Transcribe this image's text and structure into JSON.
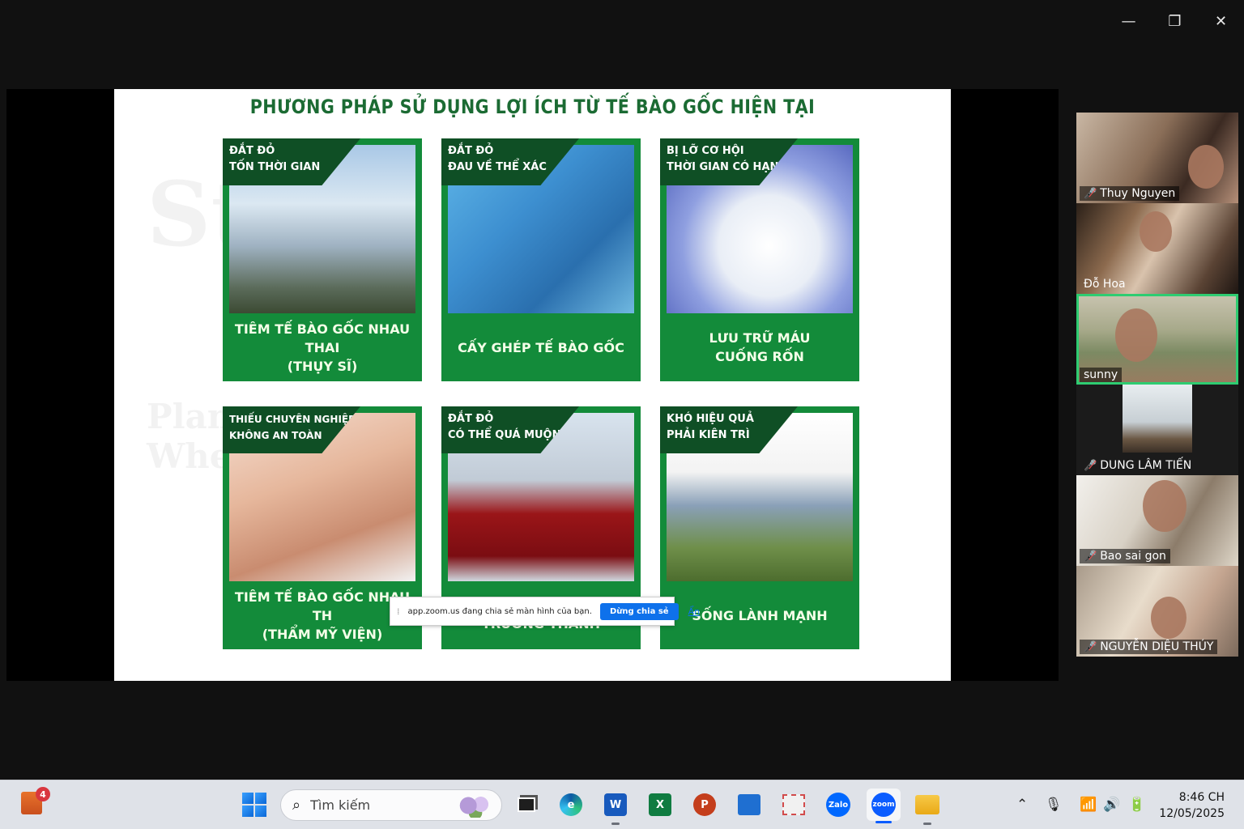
{
  "window_controls": {
    "minimize": "—",
    "restore": "❐",
    "close": "✕"
  },
  "slide": {
    "title": "PHƯƠNG PHÁP SỬ DỤNG LỢI ÍCH TỪ TẾ BÀO GỐC HIỆN TẠI",
    "cards": [
      {
        "tag": [
          "ĐẮT ĐỎ",
          "TỐN THỜI GIAN"
        ],
        "caption": [
          "TIÊM TẾ BÀO GỐC NHAU THAI",
          "(THỤY SĨ)"
        ]
      },
      {
        "tag": [
          "ĐẮT ĐỎ",
          "ĐAU VỀ THỂ XÁC"
        ],
        "caption": [
          "CẤY GHÉP TẾ BÀO GỐC"
        ]
      },
      {
        "tag": [
          "BỊ LỠ CƠ HỘI",
          "THỜI GIAN CÓ HẠN"
        ],
        "caption": [
          "LƯU TRỮ MÁU",
          "CUỐNG RỐN"
        ]
      },
      {
        "tag": [
          "THIẾU CHUYÊN NGHIỆP",
          "KHÔNG AN TOÀN"
        ],
        "caption": [
          "TIÊM TẾ BÀO GỐC NHAU TH",
          "(THẨM MỸ VIỆN)"
        ]
      },
      {
        "tag": [
          "ĐẮT ĐỎ",
          "CÓ THỂ QUÁ MUỘN"
        ],
        "caption": [
          "TRƯỞNG THÀNH"
        ]
      },
      {
        "tag": [
          "KHÓ HIỆU QUẢ",
          "PHẢI KIÊN TRÌ"
        ],
        "caption": [
          "SỐNG LÀNH MẠNH"
        ]
      }
    ]
  },
  "share_bar": {
    "message": "app.zoom.us đang chia sẻ màn hình của bạn.",
    "stop_label": "Dừng chia sẻ",
    "hide_label": "Ẩn"
  },
  "participants": [
    {
      "name": "Thuy Nguyen",
      "muted": true
    },
    {
      "name": "Đỗ Hoa",
      "muted": false
    },
    {
      "name": "sunny",
      "muted": false,
      "speaking": true
    },
    {
      "name": "DUNG LÂM TIẾN",
      "muted": true
    },
    {
      "name": "Bao sai gon",
      "muted": true
    },
    {
      "name": "NGUYỄN DIỆU THÚY",
      "muted": true
    }
  ],
  "taskbar": {
    "widget_badge": "4",
    "search_placeholder": "Tìm kiếm",
    "apps": [
      {
        "name": "task-view",
        "label": ""
      },
      {
        "name": "edge",
        "label": "e"
      },
      {
        "name": "word",
        "label": "W"
      },
      {
        "name": "excel",
        "label": "X"
      },
      {
        "name": "powerpoint",
        "label": "P"
      },
      {
        "name": "store",
        "label": ""
      },
      {
        "name": "snipping",
        "label": ""
      },
      {
        "name": "zalo",
        "label": "Zalo"
      },
      {
        "name": "zoom",
        "label": "zoom"
      },
      {
        "name": "file-explorer",
        "label": ""
      }
    ],
    "time": "8:46 CH",
    "date": "12/05/2025"
  }
}
